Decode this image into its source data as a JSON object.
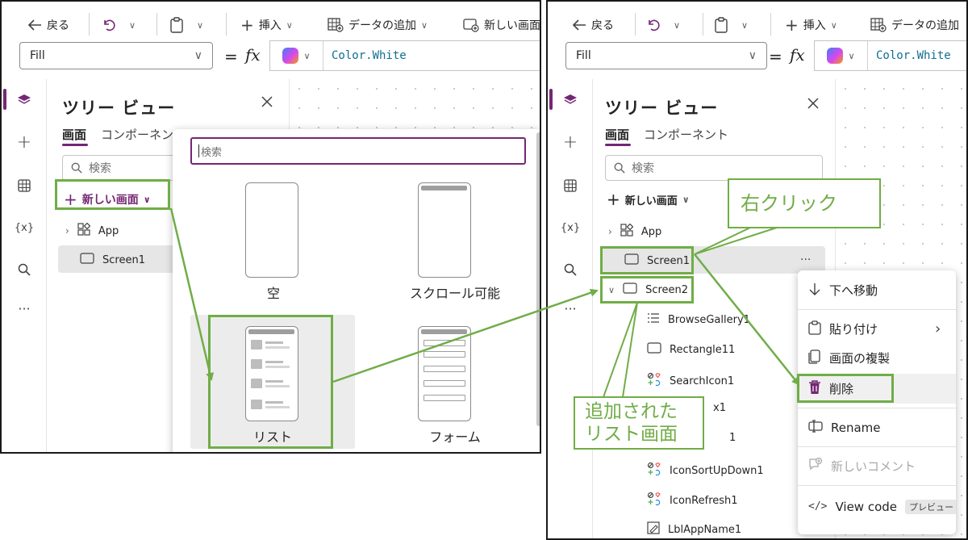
{
  "colors": {
    "accent": "#742774",
    "highlight": "#70ad47",
    "formula_text": "#0f6f8f"
  },
  "left": {
    "toolbar": {
      "back_label": "戻る",
      "insert_label": "挿入",
      "add_data_label": "データの追加",
      "new_screen_label": "新しい画面"
    },
    "property": "Fill",
    "formula": "Color.White",
    "tree": {
      "title": "ツリー ビュー",
      "tab_screens": "画面",
      "tab_components": "コンポーネント",
      "search_placeholder": "検索",
      "new_screen": "新しい画面",
      "nodes": [
        {
          "label": "App",
          "icon": "app-icon"
        },
        {
          "label": "Screen1",
          "icon": "screen-icon"
        }
      ]
    },
    "popup": {
      "search_placeholder": "検索",
      "templates": [
        {
          "label": "空"
        },
        {
          "label": "スクロール可能"
        },
        {
          "label": "リスト"
        },
        {
          "label": "フォーム"
        }
      ]
    }
  },
  "right": {
    "toolbar": {
      "back_label": "戻る",
      "insert_label": "挿入",
      "add_data_label": "データの追加"
    },
    "property": "Fill",
    "formula": "Color.White",
    "tree": {
      "title": "ツリー ビュー",
      "tab_screens": "画面",
      "tab_components": "コンポーネント",
      "search_placeholder": "検索",
      "new_screen": "新しい画面",
      "nodes": [
        {
          "label": "App"
        },
        {
          "label": "Screen1"
        },
        {
          "label": "Screen2"
        },
        {
          "label": "BrowseGallery1"
        },
        {
          "label": "Rectangle11"
        },
        {
          "label": "SearchIcon1"
        },
        {
          "label": "x1"
        },
        {
          "label": "1"
        },
        {
          "label": "IconSortUpDown1"
        },
        {
          "label": "IconRefresh1"
        },
        {
          "label": "LblAppName1"
        }
      ]
    },
    "context_menu": {
      "items": [
        {
          "label": "下へ移動",
          "icon": "arrow-down-icon"
        },
        {
          "label": "貼り付け",
          "icon": "paste-icon"
        },
        {
          "label": "画面の複製",
          "icon": "duplicate-icon"
        },
        {
          "label": "削除",
          "icon": "trash-icon"
        },
        {
          "label": "Rename",
          "icon": "rename-icon"
        },
        {
          "label": "新しいコメント",
          "icon": "comment-icon"
        },
        {
          "label": "View code",
          "icon": "code-icon",
          "badge": "プレビュー"
        }
      ]
    }
  },
  "annotations": {
    "right_click": "右クリック",
    "added_list_line1": "追加された",
    "added_list_line2": "リスト画面"
  }
}
